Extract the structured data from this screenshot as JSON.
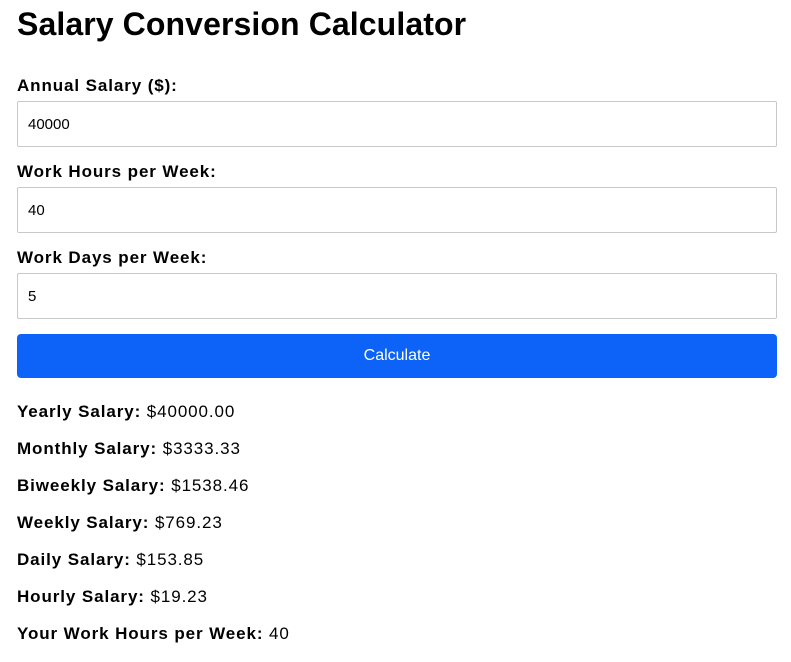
{
  "page": {
    "title": "Salary Conversion Calculator"
  },
  "form": {
    "annual_salary": {
      "label": "Annual Salary ($):",
      "value": "40000"
    },
    "hours_per_week": {
      "label": "Work Hours per Week:",
      "value": "40"
    },
    "days_per_week": {
      "label": "Work Days per Week:",
      "value": "5"
    },
    "calculate_label": "Calculate"
  },
  "results": {
    "yearly": {
      "label": "Yearly Salary:",
      "value": "$40000.00"
    },
    "monthly": {
      "label": "Monthly Salary:",
      "value": "$3333.33"
    },
    "biweekly": {
      "label": "Biweekly Salary:",
      "value": "$1538.46"
    },
    "weekly": {
      "label": "Weekly Salary:",
      "value": "$769.23"
    },
    "daily": {
      "label": "Daily Salary:",
      "value": "$153.85"
    },
    "hourly": {
      "label": "Hourly Salary:",
      "value": "$19.23"
    },
    "work_hours": {
      "label": "Your Work Hours per Week:",
      "value": "40"
    }
  },
  "colors": {
    "accent": "#0d63f8",
    "input_border": "#c8c8c8",
    "text": "#000000",
    "button_text": "#ffffff"
  }
}
